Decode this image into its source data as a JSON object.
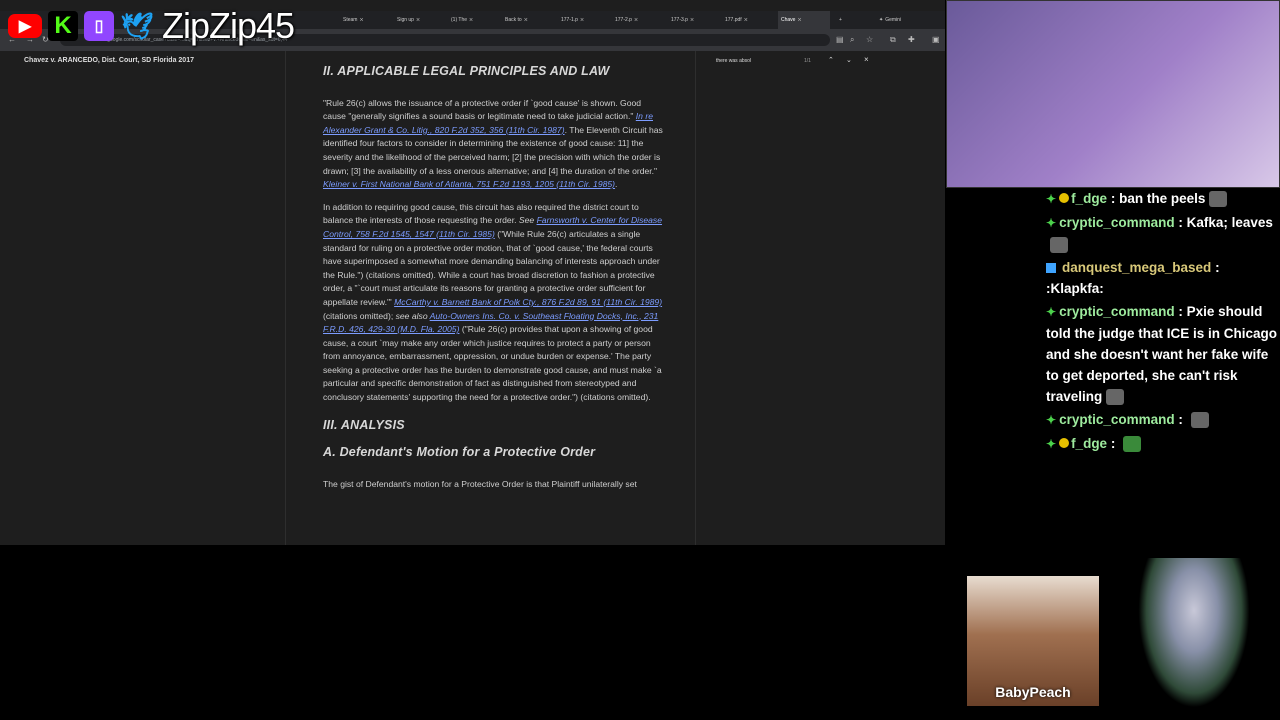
{
  "overlay": {
    "handle": "ZipZip45",
    "logos": [
      "youtube-logo",
      "kick-logo",
      "twitch-logo",
      "twitter-logo"
    ]
  },
  "browser": {
    "tabs": [
      {
        "label": "Steam"
      },
      {
        "label": "Sign up"
      },
      {
        "label": "(1) The"
      },
      {
        "label": "Back to"
      },
      {
        "label": "177-1.p"
      },
      {
        "label": "177-2.p"
      },
      {
        "label": "177-3.p"
      },
      {
        "label": "177.pdf"
      },
      {
        "label": "Chave",
        "active": true
      },
      {
        "label": "Gemini"
      }
    ],
    "url": "scholar.google.com/scholar_case?case=...&q=Chavez+v.+Arancedo&hl=en&as_sdt=6,44",
    "find": {
      "query": "there was absol",
      "count": "1/1"
    },
    "page_title": "Chavez v. ARANCEDO, Dist. Court, SD Florida 2017"
  },
  "doc": {
    "h1": "II. APPLICABLE LEGAL PRINCIPLES AND LAW",
    "p1_a": "\"Rule 26(c) allows the issuance of a protective order if `good cause' is shown. Good cause \"generally signifies a sound basis or legitimate need to take judicial action.\" ",
    "p1_link1": "In re Alexander Grant & Co. Litig., 820 F.2d 352, 356 (11th Cir. 1987)",
    "p1_b": ". The Eleventh Circuit has identified four factors to consider in determining the existence of good cause: 11] the severity and the likelihood of the perceived harm; [2] the precision with which the order is drawn; [3] the availability of a less onerous alternative; and [4] the duration of the order.\" ",
    "p1_link2": "Kleiner v. First National Bank of Atlanta, 751 F.2d 1193, 1205 (11th Cir. 1985)",
    "p1_c": ".",
    "p2_a": "In addition to requiring good cause, this circuit has also required the district court to balance the interests of those requesting the order. ",
    "p2_see": "See ",
    "p2_link1": "Farnsworth v. Center for Disease Control, 758 F.2d 1545, 1547 (11th Cir. 1985)",
    "p2_b": " (\"While Rule 26(c) articulates a single standard for ruling on a protective order motion, that of `good cause,' the federal courts have superimposed a somewhat more demanding balancing of interests approach under the Rule.\") (citations omitted). While a court has broad discretion to fashion a protective order, a \"`court must articulate its reasons for granting a protective order sufficient for appellate review.'\" ",
    "p2_link2": "McCarthy v. Barnett Bank of Polk Cty., 876 F.2d 89, 91 (11th Cir. 1989)",
    "p2_c": " (citations omitted); ",
    "p2_seealso": "see also ",
    "p2_link3": "Auto-Owners Ins. Co. v. Southeast Floating Docks, Inc., 231 F.R.D. 426, 429-30 (M.D. Fla. 2005)",
    "p2_d": " (\"Rule 26(c) provides that upon a showing of good cause, a court `may make any order which justice requires to protect a party or person from annoyance, embarrassment, oppression, or undue burden or expense.' The party seeking a protective order has the burden to demonstrate good cause, and must make `a particular and specific demonstration of fact as distinguished from stereotyped and conclusory statements' supporting the need for a protective order.\") (citations omitted).",
    "h2": "III. ANALYSIS",
    "h3": "A. Defendant's Motion for a Protective Order",
    "p3": "The gist of Defendant's motion for a Protective Order is that Plaintiff unilaterally set"
  },
  "chat": [
    {
      "user": "f_dge",
      "text": "ban the peels",
      "badge": true,
      "emote": true
    },
    {
      "user": "cryptic_command",
      "text": "Kafka; leaves",
      "emote": true
    },
    {
      "user": "danquest_mega_based",
      "text": ":Klapkfa:",
      "cube": true
    },
    {
      "user": "cryptic_command",
      "text": "Pxie should told the judge that ICE is in Chicago and she doesn't want her fake wife to get deported, she can't risk traveling",
      "emote": true
    },
    {
      "user": "cryptic_command",
      "text": "",
      "emote": true
    },
    {
      "user": "f_dge",
      "text": "",
      "badge": true,
      "emote": true
    }
  ],
  "cams": {
    "babypeach_label": "BabyPeach"
  }
}
